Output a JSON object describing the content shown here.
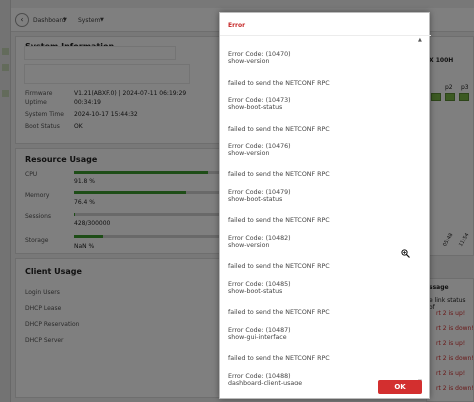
{
  "breadcrumb": {
    "dashboard": "Dashboard",
    "system": "System",
    "arrow": "▼"
  },
  "system_info": {
    "title": "System Information",
    "rows": [
      {
        "label": "Firmware",
        "value": "V1.21(ABXF.0) | 2024-07-11 06:19:29"
      },
      {
        "label": "Uptime",
        "value": "00:34:19"
      },
      {
        "label": "System Time",
        "value": "2024-10-17 15:44:32"
      },
      {
        "label": "Boot Status",
        "value": "OK"
      }
    ]
  },
  "resource_usage": {
    "title": "Resource Usage",
    "cpu": {
      "label": "CPU",
      "value": "91.8 %",
      "fraction": 0.918
    },
    "memory": {
      "label": "Memory",
      "value": "76.4 %",
      "fraction": 0.764
    },
    "sessions": {
      "label": "Sessions",
      "value": "428/300000",
      "fraction": 0.0014
    },
    "storage": {
      "label": "Storage",
      "value": "NaN %",
      "fraction": 0.2
    }
  },
  "client_usage": {
    "title": "Client Usage",
    "items": [
      "Login Users",
      "DHCP Lease",
      "DHCP Reservation",
      "DHCP Server"
    ]
  },
  "right_panel": {
    "model": "X 100H",
    "ports": [
      "p2",
      "p3"
    ],
    "column_header": "ssage",
    "link_text": "e link status of",
    "events": [
      "rt 2 is up!",
      "rt 2 is down!",
      "rt 2 is up!",
      "rt 2 is down!",
      "rt 2 is up!",
      "rt 2 is down!"
    ],
    "axis_labels": [
      "05:48",
      "11:54"
    ]
  },
  "modal": {
    "title": "Error",
    "messages": [
      "Error Code: (10470)",
      "show-version",
      "failed to send the NETCONF RPC",
      "Error Code: (10473)",
      "show-boot-status",
      "failed to send the NETCONF RPC",
      "Error Code: (10476)",
      "show-version",
      "failed to send the NETCONF RPC",
      "Error Code: (10479)",
      "show-boot-status",
      "failed to send the NETCONF RPC",
      "Error Code: (10482)",
      "show-version",
      "failed to send the NETCONF RPC",
      "Error Code: (10485)",
      "show-boot-status",
      "failed to send the NETCONF RPC",
      "Error Code: (10487)",
      "show-gui-interface",
      "failed to send the NETCONF RPC",
      "Error Code: (10488)",
      "dashboard-client-usage"
    ],
    "ok_label": "OK",
    "scroll_up": "▲",
    "scroll_down": "▼"
  },
  "colors": {
    "accent_red": "#d32f2f",
    "bar_green": "#3d9b2e"
  }
}
